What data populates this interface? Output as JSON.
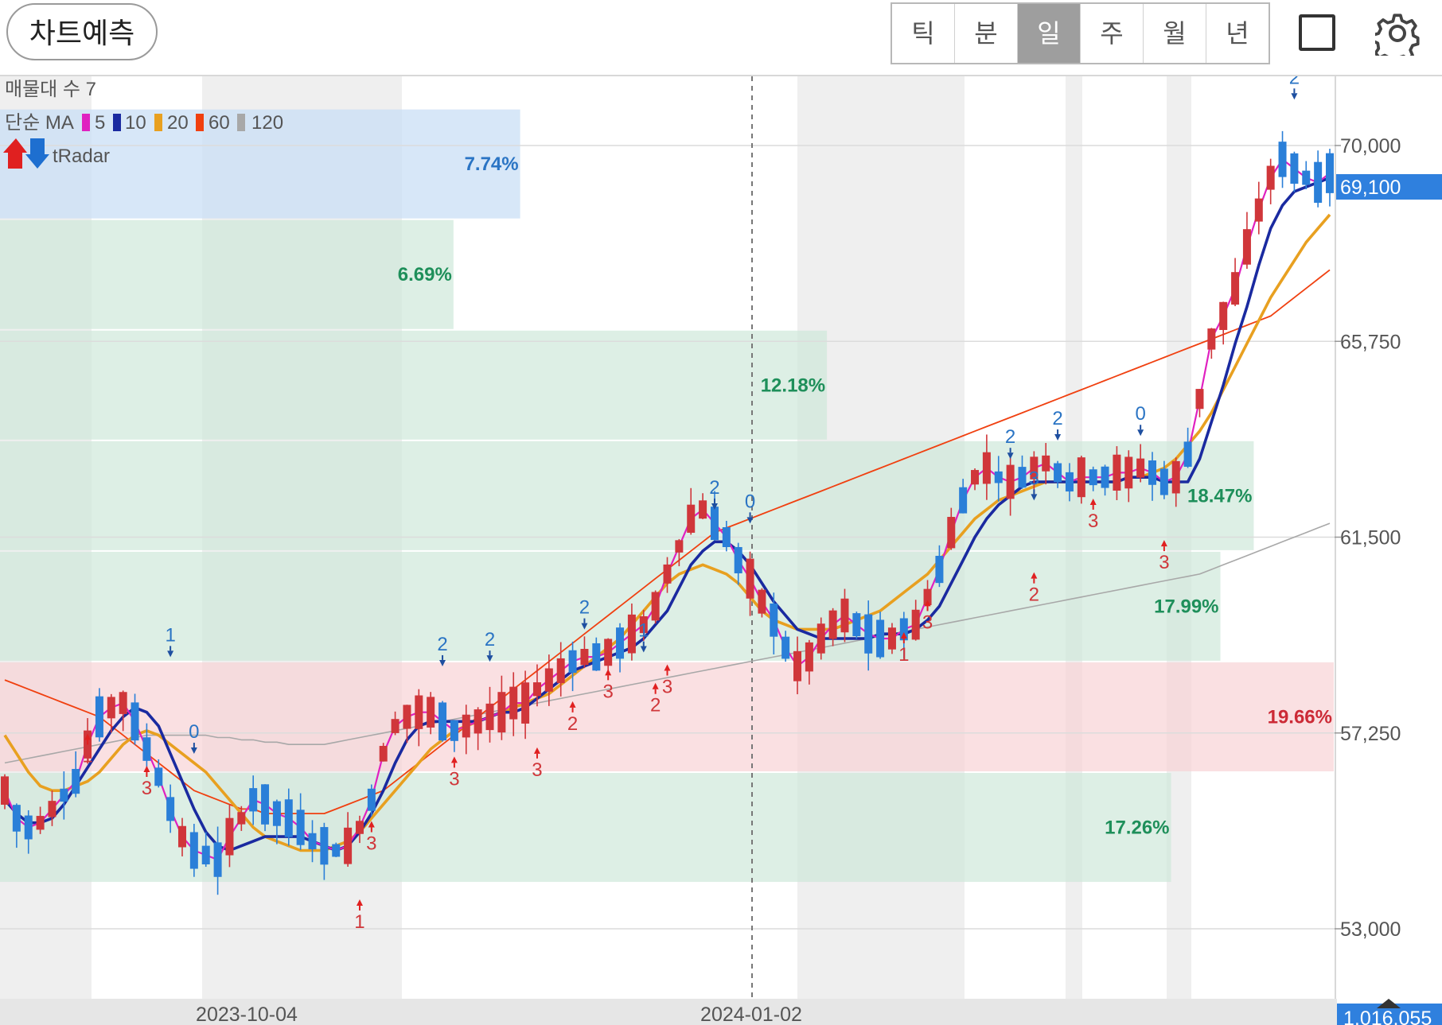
{
  "toolbar": {
    "predict_label": "차트예측",
    "periods": [
      "틱",
      "분",
      "일",
      "주",
      "월",
      "년"
    ],
    "selected_period": "일",
    "square_icon": "square-icon",
    "settings_icon": "gear-icon"
  },
  "legend": {
    "volume_profile": "매물대 수 7",
    "ma_title": "단순 MA",
    "ma_periods": [
      {
        "label": "5",
        "color": "#e020c0"
      },
      {
        "label": "10",
        "color": "#1a2aa0"
      },
      {
        "label": "20",
        "color": "#e8a020"
      },
      {
        "label": "60",
        "color": "#f04010"
      },
      {
        "label": "120",
        "color": "#a8a8a8"
      }
    ],
    "tradar": "tRadar"
  },
  "chart_data": {
    "type": "candlestick",
    "price_axis": {
      "ticks": [
        {
          "value": 70000,
          "label": "70,000"
        },
        {
          "value": 65750,
          "label": "65,750"
        },
        {
          "value": 61500,
          "label": "61,500"
        },
        {
          "value": 57250,
          "label": "57,250"
        },
        {
          "value": 53000,
          "label": "53,000"
        }
      ],
      "range": [
        51000,
        71400
      ]
    },
    "current_price": {
      "value": 69100,
      "label": "69,100",
      "color": "#2f80de"
    },
    "date_labels": [
      "2023-10-04",
      "2024-01-02"
    ],
    "bottom_partial_label": "1,016,055",
    "up_color": "#d0363a",
    "down_color": "#2a7fd8",
    "volume_profile": [
      {
        "low": 68400,
        "high": 70800,
        "pct": "7.74%",
        "type": "up",
        "strength": 0.39
      },
      {
        "low": 66000,
        "high": 68400,
        "pct": "6.69%",
        "type": "mid",
        "strength": 0.34
      },
      {
        "low": 63600,
        "high": 66000,
        "pct": "12.18%",
        "type": "mid",
        "strength": 0.62
      },
      {
        "low": 61200,
        "high": 63600,
        "pct": "18.47%",
        "type": "mid",
        "strength": 0.94
      },
      {
        "low": 58800,
        "high": 61200,
        "pct": "17.99%",
        "type": "mid",
        "strength": 0.915
      },
      {
        "low": 56400,
        "high": 58800,
        "pct": "19.66%",
        "type": "down",
        "strength": 1.0
      },
      {
        "low": 54000,
        "high": 56400,
        "pct": "17.26%",
        "type": "mid",
        "strength": 0.878
      }
    ],
    "ma_series": [
      {
        "name": "5",
        "values": [
          56000,
          55400,
          55200,
          55300,
          55600,
          55900,
          56200,
          57000,
          57600,
          57800,
          57900,
          57500,
          56900,
          56300,
          55600,
          55000,
          54700,
          54600,
          54500,
          55000,
          55400,
          55800,
          55700,
          55500,
          55400,
          55200,
          54900,
          54800,
          54700,
          54800,
          55200,
          55800,
          56800,
          57400,
          57600,
          57700,
          57700,
          57500,
          57300,
          57400,
          57500,
          57600,
          57700,
          57900,
          57900,
          58200,
          58400,
          58600,
          58800,
          58900,
          58900,
          59000,
          59200,
          59400,
          59600,
          60000,
          60700,
          61300,
          61900,
          62100,
          61800,
          61500,
          61000,
          60600,
          60100,
          59700,
          59100,
          58700,
          58900,
          59300,
          59600,
          59800,
          59600,
          59400,
          59300,
          59300,
          59500,
          59600,
          60200,
          60800,
          61600,
          62300,
          62800,
          63000,
          62800,
          62700,
          62800,
          63000,
          63100,
          62900,
          62700,
          62800,
          62800,
          62800,
          62900,
          62900,
          63000,
          62900,
          62700,
          62800,
          63300,
          64500,
          65800,
          66300,
          66900,
          67800,
          68600,
          69300,
          69700,
          69500,
          69300,
          69200,
          69400
        ]
      },
      {
        "name": "10",
        "values": [
          55800,
          55500,
          55300,
          55300,
          55400,
          55700,
          56100,
          56500,
          56900,
          57300,
          57600,
          57800,
          57700,
          57400,
          56800,
          56200,
          55600,
          55100,
          54800,
          54700,
          54800,
          54900,
          55000,
          55000,
          55000,
          55000,
          54900,
          54800,
          54700,
          54800,
          55100,
          55500,
          56000,
          56600,
          57100,
          57400,
          57500,
          57500,
          57500,
          57500,
          57500,
          57600,
          57700,
          57700,
          57800,
          58000,
          58200,
          58400,
          58600,
          58700,
          58800,
          58900,
          59000,
          59100,
          59300,
          59600,
          59900,
          60400,
          60900,
          61200,
          61400,
          61400,
          61200,
          60900,
          60500,
          60100,
          59800,
          59500,
          59400,
          59300,
          59300,
          59300,
          59300,
          59300,
          59400,
          59400,
          59400,
          59500,
          59700,
          60000,
          60500,
          61000,
          61500,
          61900,
          62200,
          62400,
          62600,
          62700,
          62700,
          62700,
          62700,
          62700,
          62700,
          62700,
          62700,
          62800,
          62800,
          62800,
          62700,
          62700,
          62700,
          63200,
          64000,
          64800,
          65700,
          66500,
          67400,
          68200,
          68700,
          69000,
          69100,
          69200,
          69300
        ]
      },
      {
        "name": "20",
        "values": [
          57200,
          56800,
          56400,
          56100,
          56000,
          56000,
          56100,
          56200,
          56400,
          56700,
          57000,
          57200,
          57300,
          57200,
          57000,
          56800,
          56600,
          56400,
          56100,
          55800,
          55500,
          55200,
          55000,
          54900,
          54800,
          54700,
          54700,
          54700,
          54800,
          54900,
          55100,
          55400,
          55700,
          56000,
          56300,
          56600,
          56900,
          57100,
          57300,
          57400,
          57500,
          57600,
          57700,
          57800,
          57900,
          58000,
          58100,
          58300,
          58500,
          58700,
          58900,
          59100,
          59300,
          59600,
          59900,
          60200,
          60500,
          60700,
          60800,
          60900,
          60800,
          60700,
          60500,
          60200,
          59900,
          59700,
          59600,
          59500,
          59500,
          59500,
          59500,
          59600,
          59700,
          59800,
          59900,
          60100,
          60300,
          60500,
          60700,
          61000,
          61300,
          61600,
          61900,
          62100,
          62300,
          62400,
          62500,
          62600,
          62700,
          62700,
          62700,
          62700,
          62700,
          62700,
          62700,
          62800,
          62800,
          62900,
          63000,
          63200,
          63500,
          63800,
          64200,
          64700,
          65200,
          65700,
          66200,
          66700,
          67100,
          67500,
          67900,
          68200,
          68500
        ]
      },
      {
        "name": "60",
        "values": [
          58400,
          58300,
          58200,
          58100,
          58000,
          57900,
          57800,
          57700,
          57600,
          57400,
          57200,
          57000,
          56800,
          56600,
          56400,
          56200,
          56000,
          55900,
          55800,
          55700,
          55600,
          55600,
          55500,
          55500,
          55500,
          55500,
          55500,
          55500,
          55600,
          55700,
          55800,
          55900,
          56000,
          56200,
          56400,
          56600,
          56800,
          57000,
          57200,
          57400,
          57600,
          57800,
          58000,
          58200,
          58400,
          58600,
          58800,
          59000,
          59200,
          59400,
          59600,
          59800,
          60000,
          60200,
          60400,
          60600,
          60800,
          61000,
          61200,
          61400,
          61600,
          61700,
          61800,
          61900,
          62000,
          62100,
          62200,
          62300,
          62400,
          62500,
          62600,
          62700,
          62800,
          62900,
          63000,
          63100,
          63200,
          63300,
          63400,
          63500,
          63600,
          63700,
          63800,
          63900,
          64000,
          64100,
          64200,
          64300,
          64400,
          64500,
          64600,
          64700,
          64800,
          64900,
          65000,
          65100,
          65200,
          65300,
          65400,
          65500,
          65600,
          65700,
          65800,
          65900,
          66000,
          66100,
          66200,
          66300,
          66500,
          66700,
          66900,
          67100,
          67300
        ]
      },
      {
        "name": "120",
        "values": [
          56600,
          56650,
          56700,
          56750,
          56800,
          56850,
          56900,
          56950,
          57000,
          57050,
          57100,
          57150,
          57200,
          57200,
          57200,
          57200,
          57200,
          57200,
          57150,
          57150,
          57100,
          57100,
          57050,
          57050,
          57000,
          57000,
          57000,
          57000,
          57050,
          57100,
          57150,
          57200,
          57250,
          57300,
          57350,
          57400,
          57450,
          57500,
          57550,
          57600,
          57650,
          57700,
          57750,
          57800,
          57850,
          57900,
          57950,
          58000,
          58050,
          58100,
          58150,
          58200,
          58250,
          58300,
          58350,
          58400,
          58450,
          58500,
          58550,
          58600,
          58650,
          58700,
          58750,
          58800,
          58850,
          58900,
          58950,
          59000,
          59050,
          59100,
          59150,
          59200,
          59250,
          59300,
          59350,
          59400,
          59450,
          59500,
          59550,
          59600,
          59650,
          59700,
          59750,
          59800,
          59850,
          59900,
          59950,
          60000,
          60050,
          60100,
          60150,
          60200,
          60250,
          60300,
          60350,
          60400,
          60450,
          60500,
          60550,
          60600,
          60650,
          60700,
          60800,
          60900,
          61000,
          61100,
          61200,
          61300,
          61400,
          61500,
          61600,
          61700,
          61800
        ]
      }
    ],
    "signals": [
      {
        "i": 7,
        "price": 57100,
        "label": "1",
        "dir": "up"
      },
      {
        "i": 14,
        "price": 59000,
        "label": "1",
        "dir": "down"
      },
      {
        "i": 12,
        "price": 56400,
        "label": "3",
        "dir": "up"
      },
      {
        "i": 16,
        "price": 56900,
        "label": "0",
        "dir": "down"
      },
      {
        "i": 31,
        "price": 55200,
        "label": "3",
        "dir": "up"
      },
      {
        "i": 30,
        "price": 53500,
        "label": "1",
        "dir": "up"
      },
      {
        "i": 37,
        "price": 58800,
        "label": "2",
        "dir": "down"
      },
      {
        "i": 38,
        "price": 56600,
        "label": "3",
        "dir": "up"
      },
      {
        "i": 41,
        "price": 58900,
        "label": "2",
        "dir": "down"
      },
      {
        "i": 45,
        "price": 56800,
        "label": "3",
        "dir": "up"
      },
      {
        "i": 48,
        "price": 57800,
        "label": "2",
        "dir": "up"
      },
      {
        "i": 51,
        "price": 58500,
        "label": "3",
        "dir": "up"
      },
      {
        "i": 49,
        "price": 59600,
        "label": "2",
        "dir": "down"
      },
      {
        "i": 54,
        "price": 59100,
        "label": "1",
        "dir": "down"
      },
      {
        "i": 55,
        "price": 58200,
        "label": "2",
        "dir": "up"
      },
      {
        "i": 56,
        "price": 58600,
        "label": "3",
        "dir": "up"
      },
      {
        "i": 60,
        "price": 62200,
        "label": "2",
        "dir": "down"
      },
      {
        "i": 63,
        "price": 61900,
        "label": "0",
        "dir": "down"
      },
      {
        "i": 76,
        "price": 59300,
        "label": "1",
        "dir": "up"
      },
      {
        "i": 78,
        "price": 60000,
        "label": "3",
        "dir": "up"
      },
      {
        "i": 85,
        "price": 63300,
        "label": "2",
        "dir": "down"
      },
      {
        "i": 87,
        "price": 62400,
        "label": "3",
        "dir": "down"
      },
      {
        "i": 87,
        "price": 60600,
        "label": "2",
        "dir": "up"
      },
      {
        "i": 89,
        "price": 63700,
        "label": "2",
        "dir": "down"
      },
      {
        "i": 92,
        "price": 62200,
        "label": "3",
        "dir": "up"
      },
      {
        "i": 96,
        "price": 63800,
        "label": "0",
        "dir": "down"
      },
      {
        "i": 98,
        "price": 61300,
        "label": "3",
        "dir": "up"
      },
      {
        "i": 109,
        "price": 71100,
        "label": "2",
        "dir": "down"
      }
    ]
  }
}
